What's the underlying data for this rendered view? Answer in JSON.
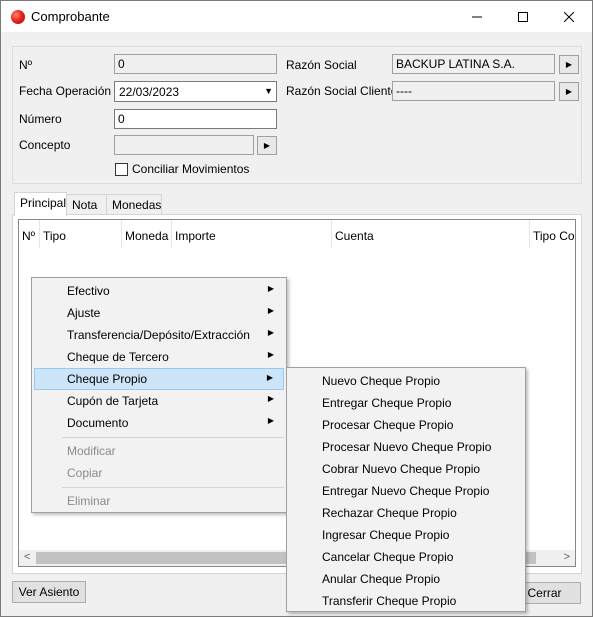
{
  "window": {
    "title": "Comprobante"
  },
  "header": {
    "nro_label": "Nº",
    "nro_value": "0",
    "fecha_label": "Fecha Operación",
    "fecha_value": "22/03/2023",
    "numero_label": "Número",
    "numero_value": "0",
    "concepto_label": "Concepto",
    "concepto_value": "",
    "conciliar_label": "Conciliar Movimientos",
    "conciliar_checked": false,
    "razon_social_label": "Razón Social",
    "razon_social_value": "BACKUP LATINA S.A.",
    "razon_social_cliente_label": "Razón Social Cliente",
    "razon_social_cliente_value": "----"
  },
  "tabs": [
    {
      "label": "Principal",
      "active": true
    },
    {
      "label": "Nota",
      "active": false
    },
    {
      "label": "Monedas",
      "active": false
    }
  ],
  "grid": {
    "columns": [
      "Nº",
      "Tipo",
      "Moneda",
      "Importe",
      "Cuenta",
      "Tipo Cor"
    ]
  },
  "context_menu": {
    "items": [
      {
        "label": "Efectivo"
      },
      {
        "label": "Ajuste"
      },
      {
        "label": "Transferencia/Depósito/Extracción"
      },
      {
        "label": "Cheque de Tercero"
      },
      {
        "label": "Cheque Propio"
      },
      {
        "label": "Cupón de Tarjeta"
      },
      {
        "label": "Documento"
      },
      {
        "label": "Modificar"
      },
      {
        "label": "Copiar"
      },
      {
        "label": "Eliminar"
      }
    ]
  },
  "submenu": {
    "items": [
      {
        "label": "Nuevo Cheque Propio"
      },
      {
        "label": "Entregar Cheque Propio"
      },
      {
        "label": "Procesar Cheque Propio"
      },
      {
        "label": "Procesar Nuevo Cheque Propio"
      },
      {
        "label": "Cobrar Nuevo Cheque Propio"
      },
      {
        "label": "Entregar Nuevo Cheque Propio"
      },
      {
        "label": "Rechazar Cheque Propio"
      },
      {
        "label": "Ingresar Cheque Propio"
      },
      {
        "label": "Cancelar Cheque Propio"
      },
      {
        "label": "Anular Cheque Propio"
      },
      {
        "label": "Transferir Cheque Propio"
      }
    ]
  },
  "footer": {
    "ver_asiento_label": "Ver Asiento",
    "cerrar_label": "Cerrar"
  }
}
